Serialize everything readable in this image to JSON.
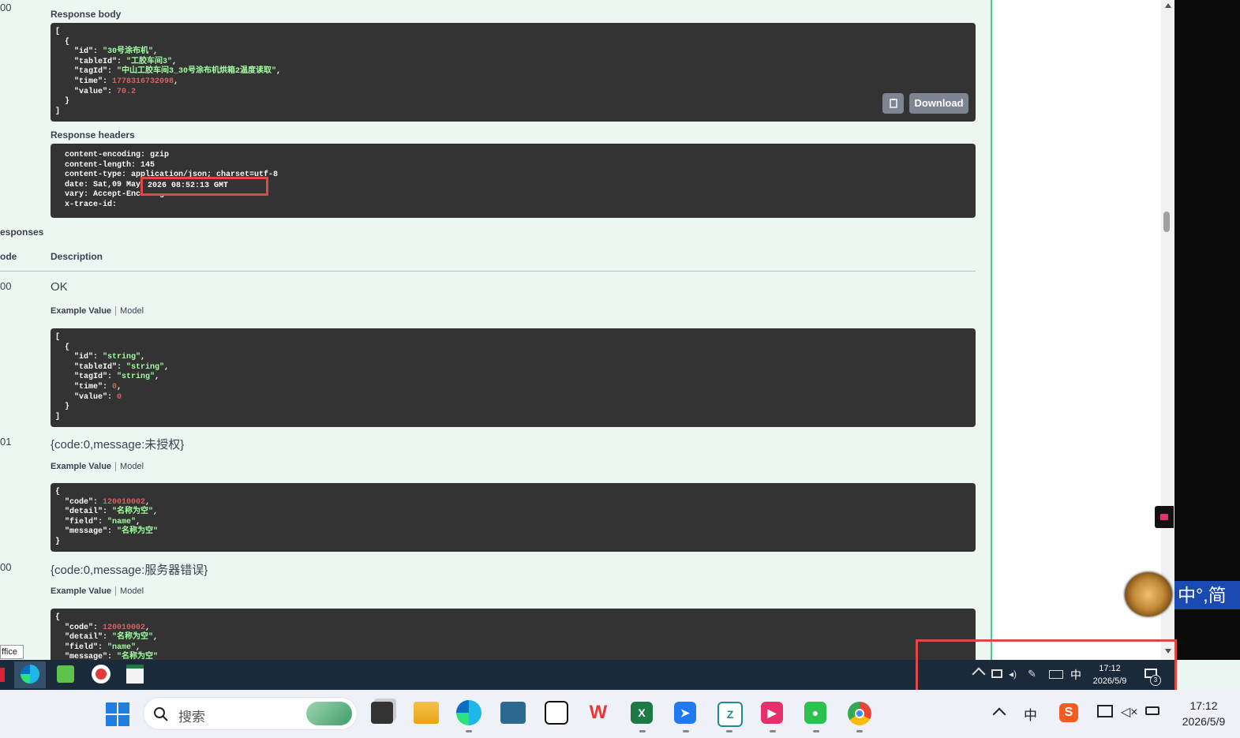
{
  "left_codes": {
    "c0": "00",
    "responses_label": "esponses",
    "code_label": "ode",
    "c200": "00",
    "c401": "01",
    "c500": "00",
    "office_label": "ffice"
  },
  "response_body": {
    "title": "Response body",
    "lines": [
      {
        "t": "["
      },
      {
        "t": "  {"
      },
      {
        "k": "    \"id\": ",
        "v": "\"30号涂布机\"",
        "vt": "s",
        "e": ","
      },
      {
        "k": "    \"tableId\": ",
        "v": "\"工胶车间3\"",
        "vt": "s",
        "e": ","
      },
      {
        "k": "    \"tagId\": ",
        "v": "\"中山工胶车间3_30号涂布机烘箱2温度读取\"",
        "vt": "s",
        "e": ","
      },
      {
        "k": "    \"time\": ",
        "v": "1778316732098",
        "vt": "n",
        "e": ","
      },
      {
        "k": "    \"value\": ",
        "v": "70.2",
        "vt": "n",
        "e": ""
      },
      {
        "t": "  }"
      },
      {
        "t": "]"
      }
    ],
    "download_label": "Download"
  },
  "response_headers": {
    "title": "Response headers",
    "lines": [
      "  content-encoding: gzip",
      "  content-length: 145",
      "  content-type: application/json; charset=utf-8",
      "  date: Sat,09 May",
      "  vary: Accept-Encoding",
      "  x-trace-id:"
    ],
    "highlight": "2026 08:52:13 GMT"
  },
  "responses": {
    "description_label": "Description",
    "example_value_label": "Example Value",
    "model_label": "Model",
    "ok_label": "OK",
    "r200_lines": [
      {
        "t": "["
      },
      {
        "t": "  {"
      },
      {
        "k": "    \"id\": ",
        "v": "\"string\"",
        "vt": "s",
        "e": ","
      },
      {
        "k": "    \"tableId\": ",
        "v": "\"string\"",
        "vt": "s",
        "e": ","
      },
      {
        "k": "    \"tagId\": ",
        "v": "\"string\"",
        "vt": "s",
        "e": ","
      },
      {
        "k": "    \"time\": ",
        "v": "0",
        "vt": "n",
        "e": ","
      },
      {
        "k": "    \"value\": ",
        "v": "0",
        "vt": "n",
        "e": ""
      },
      {
        "t": "  }"
      },
      {
        "t": "]"
      }
    ],
    "r401_desc": "{code:0,message:未授权}",
    "r401_lines": [
      {
        "t": "{"
      },
      {
        "k": "  \"code\": ",
        "v": "120010002",
        "vt": "n",
        "e": ","
      },
      {
        "k": "  \"detail\": ",
        "v": "\"名称为空\"",
        "vt": "s",
        "e": ","
      },
      {
        "k": "  \"field\": ",
        "v": "\"name\"",
        "vt": "s",
        "e": ","
      },
      {
        "k": "  \"message\": ",
        "v": "\"名称为空\"",
        "vt": "s",
        "e": ""
      },
      {
        "t": "}"
      }
    ],
    "r500_desc": "{code:0,message:服务器错误}",
    "r500_lines": [
      {
        "t": "{"
      },
      {
        "k": "  \"code\": ",
        "v": "120010002",
        "vt": "n",
        "e": ","
      },
      {
        "k": "  \"detail\": ",
        "v": "\"名称为空\"",
        "vt": "s",
        "e": ","
      },
      {
        "k": "  \"field\": ",
        "v": "\"name\"",
        "vt": "s",
        "e": ","
      },
      {
        "k": "  \"message\": ",
        "v": "\"名称为空\"",
        "vt": "s",
        "e": ""
      }
    ]
  },
  "ime_bar": {
    "label": "中°,简"
  },
  "inner_tray": {
    "ime": "中",
    "time": "17:12",
    "date": "2026/5/9",
    "notif_count": "3"
  },
  "taskbar": {
    "search_placeholder": "搜索",
    "ime": "中",
    "time": "17:12",
    "date": "2026/5/9"
  },
  "icons": [
    "edge-icon",
    "wps-icon",
    "excel-icon",
    "wechat-icon",
    "chrome-icon",
    "explorer-icon",
    "windows-start-icon",
    "search-icon"
  ]
}
